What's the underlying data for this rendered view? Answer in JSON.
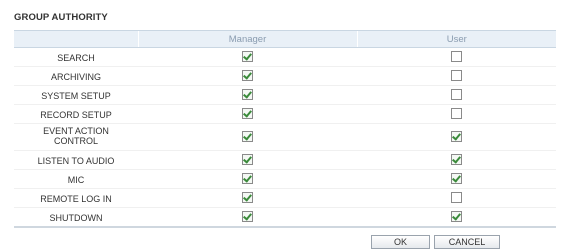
{
  "section": {
    "title": "GROUP AUTHORITY"
  },
  "columns": {
    "manager": "Manager",
    "user": "User"
  },
  "permissions": [
    {
      "label": "SEARCH",
      "manager": true,
      "user": false
    },
    {
      "label": "ARCHIVING",
      "manager": true,
      "user": false
    },
    {
      "label": "SYSTEM SETUP",
      "manager": true,
      "user": false
    },
    {
      "label": "RECORD SETUP",
      "manager": true,
      "user": false
    },
    {
      "label": "EVENT ACTION CONTROL",
      "manager": true,
      "user": true
    },
    {
      "label": "LISTEN TO AUDIO",
      "manager": true,
      "user": true
    },
    {
      "label": "MIC",
      "manager": true,
      "user": true
    },
    {
      "label": "REMOTE LOG IN",
      "manager": true,
      "user": false
    },
    {
      "label": "SHUTDOWN",
      "manager": true,
      "user": true
    }
  ],
  "buttons": {
    "ok": "OK",
    "cancel": "CANCEL"
  },
  "colors": {
    "header_bg": "#e9f0f7",
    "header_text": "#8a9cb0",
    "check_mark": "#3a8a3a"
  }
}
